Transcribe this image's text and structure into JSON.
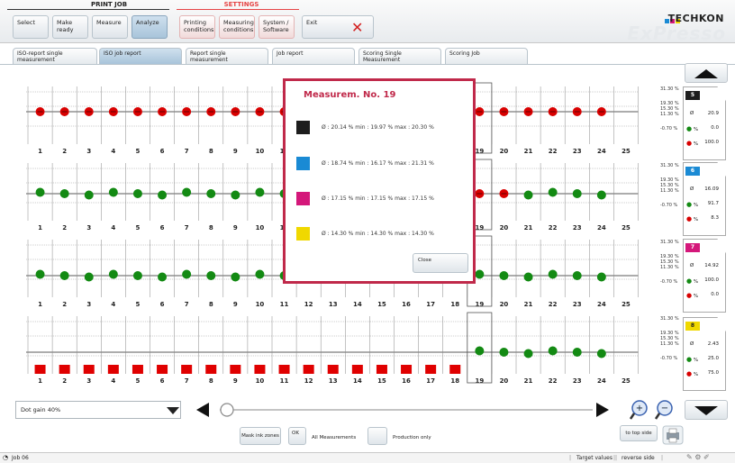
{
  "toolbar": {
    "print_job_title": "PRINT JOB",
    "settings_title": "SETTINGS",
    "buttons": {
      "select": "Select",
      "make_ready": "Make ready",
      "measure": "Measure",
      "analyze": "Analyze",
      "printing_conditions": "Printing conditions",
      "measuring_conditions": "Measuring conditions",
      "system_software": "System / Software",
      "exit": "Exit"
    }
  },
  "logo": {
    "brand": "TECHKON",
    "product": "ExPresso"
  },
  "tabs": [
    "ISO-report single measurement",
    "ISO job report",
    "Report single measurement",
    "Job report",
    "Scoring Single Measurement",
    "Scoring Job"
  ],
  "active_tab": "ISO job report",
  "popup": {
    "title": "Measurem. No. 19",
    "rows": [
      {
        "color": "#1d1d1d",
        "text": "Ø : 20.14 %   min : 19.97 %   max : 20.30 %"
      },
      {
        "color": "#1a8ad4",
        "text": "Ø : 18.74 %   min : 16.17 %   max : 21.31 %"
      },
      {
        "color": "#d4177a",
        "text": "Ø : 17.15 %   min : 17.15 %   max : 17.15 %"
      },
      {
        "color": "#f0d800",
        "text": "Ø : 14.30 %   min : 14.30 %   max : 14.30 %"
      }
    ],
    "close": "Close"
  },
  "chart": {
    "columns": [
      "1",
      "2",
      "3",
      "4",
      "5",
      "6",
      "7",
      "8",
      "9",
      "10",
      "11",
      "12",
      "13",
      "14",
      "15",
      "16",
      "17",
      "18",
      "19",
      "20",
      "21",
      "22",
      "23",
      "24",
      "25"
    ],
    "scale_labels": [
      "31.30 %",
      "19.30 %",
      "15.30 %",
      "11.30 %",
      "-0.70 %"
    ],
    "rows": [
      {
        "marks": [
          "red",
          "red",
          "red",
          "red",
          "red",
          "red",
          "red",
          "red",
          "red",
          "red",
          "red",
          "red",
          "red",
          "red",
          "red",
          "red",
          "red",
          "red",
          "red",
          "red",
          "red",
          "red",
          "red",
          "red",
          ""
        ]
      },
      {
        "marks": [
          "green",
          "green",
          "green",
          "green",
          "green",
          "green",
          "green",
          "green",
          "green",
          "green",
          "green",
          "green",
          "green",
          "green",
          "green",
          "green",
          "green",
          "green",
          "red",
          "red",
          "green",
          "green",
          "green",
          "green",
          ""
        ]
      },
      {
        "marks": [
          "green",
          "green",
          "green",
          "green",
          "green",
          "green",
          "green",
          "green",
          "green",
          "green",
          "green",
          "green",
          "green",
          "green",
          "green",
          "green",
          "green",
          "green",
          "green",
          "green",
          "green",
          "green",
          "green",
          "green",
          ""
        ]
      },
      {
        "marks": [
          "redbar",
          "redbar",
          "redbar",
          "redbar",
          "redbar",
          "redbar",
          "redbar",
          "redbar",
          "redbar",
          "redbar",
          "redbar",
          "redbar",
          "redbar",
          "redbar",
          "redbar",
          "redbar",
          "redbar",
          "redbar",
          "green",
          "green",
          "green",
          "green",
          "green",
          "green",
          ""
        ]
      }
    ]
  },
  "cards": [
    {
      "id": "5",
      "color": "#1d1d1d",
      "id_text_color": "#ffffff",
      "avg": "20.9",
      "green_pct": "0.0",
      "red_pct": "100.0"
    },
    {
      "id": "6",
      "color": "#1a8ad4",
      "id_text_color": "#ffffff",
      "avg": "16.09",
      "green_pct": "91.7",
      "red_pct": "8.3"
    },
    {
      "id": "7",
      "color": "#d4177a",
      "id_text_color": "#ffffff",
      "avg": "14.92",
      "green_pct": "100.0",
      "red_pct": "0.0"
    },
    {
      "id": "8",
      "color": "#f0d800",
      "id_text_color": "#222222",
      "avg": "2.43",
      "green_pct": "25.0",
      "red_pct": "75.0"
    }
  ],
  "card_labels": {
    "avg": "Ø",
    "pct": "%"
  },
  "controls": {
    "dropdown_value": "Dot gain 40%",
    "mask_ink_zones": "Mask ink zones",
    "ok": "OK",
    "all_measurements": "All Measurements",
    "production_only": "Production only",
    "to_top_side": "to top side"
  },
  "status": {
    "job": "Job 06",
    "target_values": "Target values",
    "reverse_side": "reverse side"
  }
}
